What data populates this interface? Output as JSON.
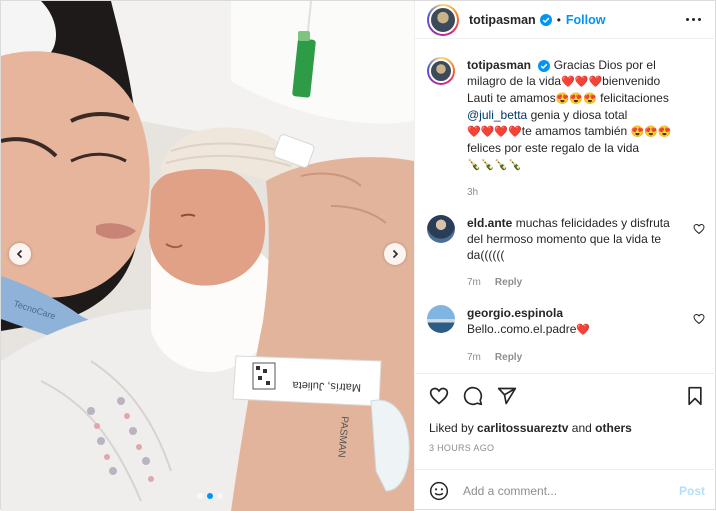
{
  "post": {
    "username": "totipasman",
    "follow_label": "Follow",
    "separator": "•",
    "caption": {
      "username": "totipasman",
      "p1": "Gracias Dios por el milagro de la vida",
      "e1": "❤️❤️❤️",
      "p2": "bienvenido Lauti te amamos",
      "e2": "😍😍😍",
      "p3": "felicitaciones",
      "mention": "@juli_betta",
      "p4": "genia y diosa total",
      "e3": "❤️❤️❤️❤️",
      "p5": "te amamos también",
      "e4": "😍😍😍",
      "p6": "felices por este regalo de la vida",
      "e5": "🍾🍾🍾🍾",
      "age": "3h"
    },
    "comments": [
      {
        "username": "eld.ante",
        "text": "muchas felicidades y disfruta del hermoso momento que la vida te da((((((",
        "age": "7m",
        "reply_label": "Reply"
      },
      {
        "username": "georgio.espinola",
        "text": "Bello..como.el.padre",
        "emoji": "❤️",
        "age": "7m",
        "reply_label": "Reply"
      }
    ],
    "likes": {
      "prefix": "Liked by",
      "user": "carlitossuareztv",
      "conj": "and",
      "others": "others"
    },
    "timestamp": "3 HOURS AGO",
    "comment_box": {
      "placeholder": "Add a comment...",
      "post_label": "Post"
    },
    "photo": {
      "mask_text": "TecnoCare",
      "wristband_text": "Matrís, Julieta",
      "wristband_text2": "PASMAN"
    },
    "carousel": {
      "count": 3,
      "active": 1
    },
    "icons": {
      "verified": "verified-badge-icon",
      "more": "more-options-icon",
      "like": "heart-icon",
      "comment": "comment-icon",
      "share": "share-icon",
      "save": "bookmark-icon",
      "emoji": "emoji-icon",
      "prev": "chevron-left-icon",
      "next": "chevron-right-icon"
    },
    "colors": {
      "accent": "#0095f6",
      "text": "#262626",
      "muted": "#8e8e8e",
      "mention": "#00376b",
      "post_disabled": "#b2dffc"
    }
  }
}
